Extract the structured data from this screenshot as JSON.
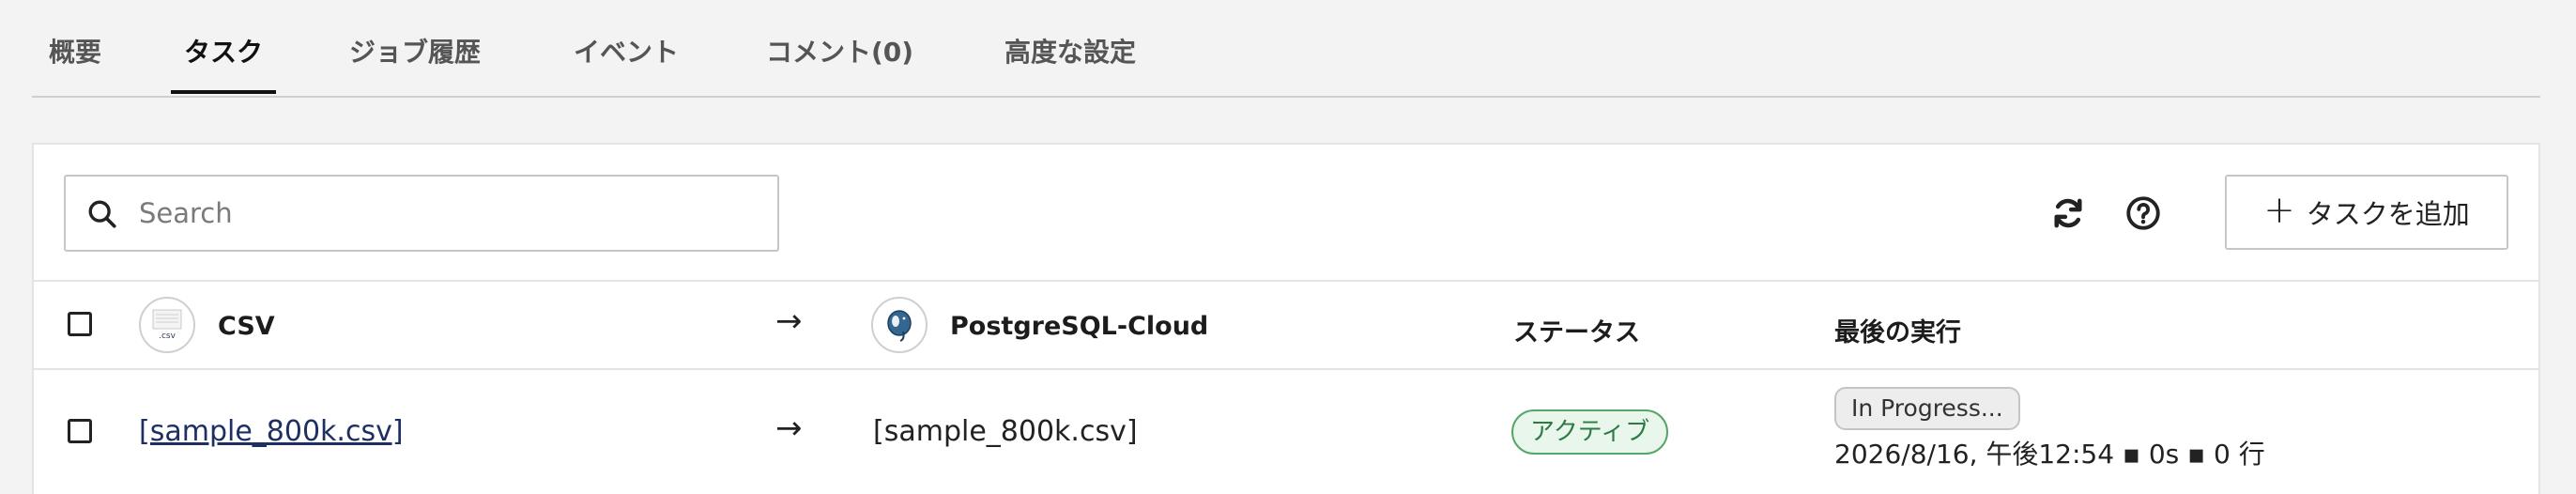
{
  "tabs": [
    {
      "label": "概要",
      "active": false
    },
    {
      "label": "タスク",
      "active": true
    },
    {
      "label": "ジョブ履歴",
      "active": false
    },
    {
      "label": "イベント",
      "active": false
    },
    {
      "label": "コメント(0)",
      "active": false
    },
    {
      "label": "高度な設定",
      "active": false
    }
  ],
  "toolbar": {
    "search_placeholder": "Search",
    "search_value": "",
    "refresh_icon": "refresh-icon",
    "help_icon": "help-icon",
    "add_task_label": "タスクを追加"
  },
  "table": {
    "header": {
      "source": "CSV",
      "source_logo_text": ".csv",
      "target": "PostgreSQL-Cloud",
      "status": "ステータス",
      "last_run": "最後の実行"
    },
    "rows": [
      {
        "source": "[sample_800k.csv]",
        "target": "[sample_800k.csv]",
        "status": "アクティブ",
        "progress": "In Progress...",
        "last_run": "2026/8/16, 午後12:54 ▪ 0s ▪ 0 行"
      }
    ]
  },
  "colors": {
    "active_border": "#56a66a",
    "active_bg": "#e9f6ec",
    "link": "#1d2f63"
  }
}
